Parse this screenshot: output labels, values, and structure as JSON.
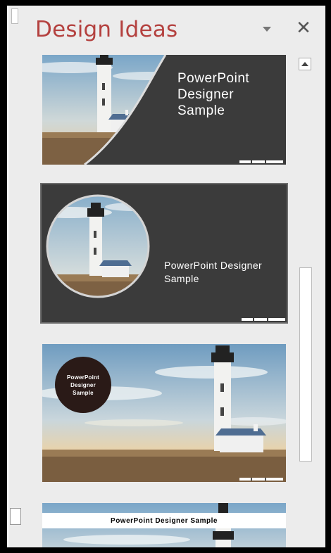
{
  "pane": {
    "title": "Design Ideas",
    "title_color": "#b4413f",
    "dropdown_icon": "chevron-down-icon",
    "close_icon": "close-icon",
    "close_glyph": "✕"
  },
  "designs": [
    {
      "text": "PowerPoint Designer Sample",
      "text_lines": [
        "PowerPoint",
        "Designer",
        "Sample"
      ]
    },
    {
      "text": "PowerPoint Designer Sample",
      "text_lines": [
        "PowerPoint Designer",
        "Sample"
      ]
    },
    {
      "text": "PowerPoint Designer Sample",
      "text_lines": [
        "PowerPoint",
        "Designer",
        "Sample"
      ]
    },
    {
      "text": "PowerPoint Designer Sample"
    }
  ],
  "colors": {
    "dark_panel": "#3a3a3a",
    "accent": "#b4413f",
    "pane_bg": "#ececec"
  }
}
